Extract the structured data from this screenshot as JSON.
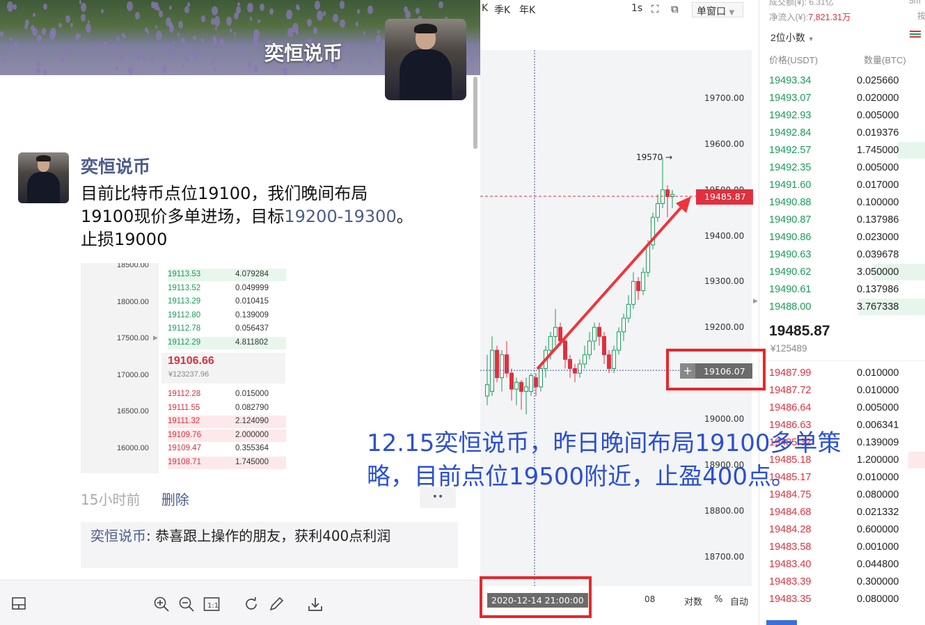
{
  "toolbar": {
    "k1": "K",
    "k2": "季K",
    "k3": "年K",
    "interval": "1s",
    "window_mode": "单窗口"
  },
  "chart": {
    "y_ticks": [
      "19700.00",
      "19600.00",
      "19500.00",
      "19400.00",
      "19300.00",
      "19200.00",
      "19100.00",
      "19000.00",
      "18900.00",
      "18800.00",
      "18700.00"
    ],
    "high_label": "19570",
    "current_price_tag": "19485.87",
    "crosshair_price": "19106.07",
    "crosshair_plus": "+",
    "crosshair_time": "2020-12-14 21:00:00",
    "x_label": "08",
    "log_label": "对数",
    "pct_label": "%",
    "auto_label": "自动"
  },
  "orderbook": {
    "turnover_label": "成交额(¥): 6.31亿",
    "netflow_label": "净流入(¥):",
    "netflow_value": "7,821.31万",
    "right_a": "5m",
    "right_b": "按",
    "precision": "2位小数",
    "col_price": "价格(USDT)",
    "col_qty": "数量(BTC)",
    "asks": [
      {
        "p": "19493.34",
        "q": "0.025660"
      },
      {
        "p": "19493.07",
        "q": "0.020000"
      },
      {
        "p": "19492.93",
        "q": "0.005000"
      },
      {
        "p": "19492.84",
        "q": "0.019376"
      },
      {
        "p": "19492.57",
        "q": "1.745000"
      },
      {
        "p": "19492.35",
        "q": "0.005000"
      },
      {
        "p": "19491.60",
        "q": "0.017000"
      },
      {
        "p": "19490.88",
        "q": "0.100000"
      },
      {
        "p": "19490.87",
        "q": "0.137986"
      },
      {
        "p": "19490.86",
        "q": "0.023000"
      },
      {
        "p": "19490.63",
        "q": "0.039678"
      },
      {
        "p": "19490.62",
        "q": "3.050000"
      },
      {
        "p": "19490.61",
        "q": "0.137986"
      },
      {
        "p": "19488.00",
        "q": "3.767338"
      }
    ],
    "mid_price": "19485.87",
    "mid_cny": "¥125489",
    "bids": [
      {
        "p": "19487.99",
        "q": "0.010000"
      },
      {
        "p": "19487.72",
        "q": "0.010000"
      },
      {
        "p": "19486.64",
        "q": "0.005000"
      },
      {
        "p": "19486.63",
        "q": "0.006341"
      },
      {
        "p": "19485.32",
        "q": "0.139009"
      },
      {
        "p": "19485.18",
        "q": "1.200000"
      },
      {
        "p": "19485.17",
        "q": "0.010000"
      },
      {
        "p": "19484.75",
        "q": "0.080000"
      },
      {
        "p": "19484.68",
        "q": "0.021332"
      },
      {
        "p": "19484.28",
        "q": "0.600000"
      },
      {
        "p": "19483.58",
        "q": "0.001000"
      },
      {
        "p": "19483.40",
        "q": "0.044800"
      },
      {
        "p": "19483.39",
        "q": "0.300000"
      },
      {
        "p": "19483.35",
        "q": "0.080000"
      }
    ]
  },
  "post": {
    "cover_title": "奕恒说币",
    "author": "奕恒说币",
    "line1": "目前比特币点位19100，我们晚间布局",
    "line2_a": "19100现价多单进场，目标",
    "line2_target": "19200-19300",
    "line2_b": "。",
    "line3": "止损19000",
    "time_ago": "15小时前",
    "delete": "删除",
    "more": "••",
    "comment_author": "奕恒说币",
    "comment_text": ": 恭喜跟上操作的朋友，获利400点利润"
  },
  "thumbnail": {
    "y_ticks": [
      "18500.00",
      "18000.00",
      "17500.00",
      "17000.00",
      "16500.00",
      "16000.00"
    ],
    "asks": [
      {
        "p": "19113.53",
        "q": "4.079284"
      },
      {
        "p": "19113.52",
        "q": "0.049999"
      },
      {
        "p": "19113.29",
        "q": "0.010415"
      },
      {
        "p": "19112.80",
        "q": "0.139009"
      },
      {
        "p": "19112.78",
        "q": "0.056437"
      },
      {
        "p": "19112.29",
        "q": "4.811802"
      }
    ],
    "mid": "19106.66",
    "mid_cny": "¥123237.96",
    "bids": [
      {
        "p": "19112.28",
        "q": "0.015000"
      },
      {
        "p": "19111.55",
        "q": "0.082790"
      },
      {
        "p": "19111.32",
        "q": "2.124090"
      },
      {
        "p": "19109.76",
        "q": "2.000000"
      },
      {
        "p": "19109.47",
        "q": "0.355364"
      },
      {
        "p": "19108.71",
        "q": "1.745000"
      }
    ]
  },
  "overlay": {
    "line1": "12.15奕恒说币，昨日晚间布局19100多单策",
    "line2": "略，目前点位19500附近，止盈400点。"
  },
  "colors": {
    "up": "#1a9b5a",
    "down": "#e0303e",
    "accent_blue": "#2a4fd6",
    "link": "#4c5c8a"
  },
  "icons": [
    "layout-icon",
    "zoom-in-icon",
    "zoom-out-icon",
    "actual-size-icon",
    "rotate-icon",
    "edit-icon",
    "download-icon",
    "fullscreen-icon",
    "window-icon",
    "menu-icon"
  ]
}
